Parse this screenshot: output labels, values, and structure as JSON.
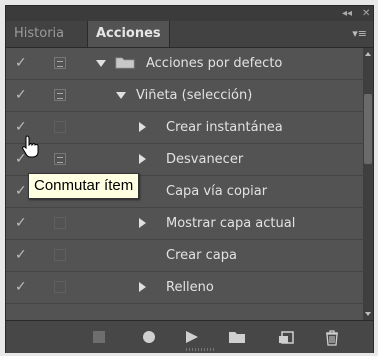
{
  "window": {
    "collapse_glyph": "◂◂",
    "close_glyph": "✕"
  },
  "tabs": [
    {
      "label": "Historia",
      "active": false
    },
    {
      "label": "Acciones",
      "active": true
    }
  ],
  "panel_menu_glyph": "▾≡",
  "actions": [
    {
      "label": "Acciones por defecto",
      "type": "set",
      "checked": true,
      "dialog": true,
      "expanded": true
    },
    {
      "label": "Viñeta (selección)",
      "type": "action",
      "checked": true,
      "dialog": true,
      "expanded": true
    },
    {
      "label": "Crear instantánea",
      "type": "step",
      "checked": true,
      "dialog": false,
      "expandable": true
    },
    {
      "label": "Desvanecer",
      "type": "step",
      "checked": true,
      "dialog": true,
      "expandable": true
    },
    {
      "label": "Capa vía copiar",
      "type": "step",
      "checked": true,
      "dialog": false,
      "expandable": false
    },
    {
      "label": "Mostrar capa actual",
      "type": "step",
      "checked": true,
      "dialog": false,
      "expandable": true
    },
    {
      "label": "Crear capa",
      "type": "step",
      "checked": true,
      "dialog": false,
      "expandable": false
    },
    {
      "label": "Relleno",
      "type": "step",
      "checked": true,
      "dialog": false,
      "expandable": true
    }
  ],
  "check_glyph": "✓",
  "tooltip": "Conmutar ítem",
  "toolbar": [
    "stop-icon",
    "record-icon",
    "play-icon",
    "new-set-folder-icon",
    "new-action-icon",
    "trash-icon"
  ],
  "colors": {
    "panel_bg": "#535353",
    "text": "#e2e2e2",
    "tooltip_bg": "#ffffe1"
  }
}
